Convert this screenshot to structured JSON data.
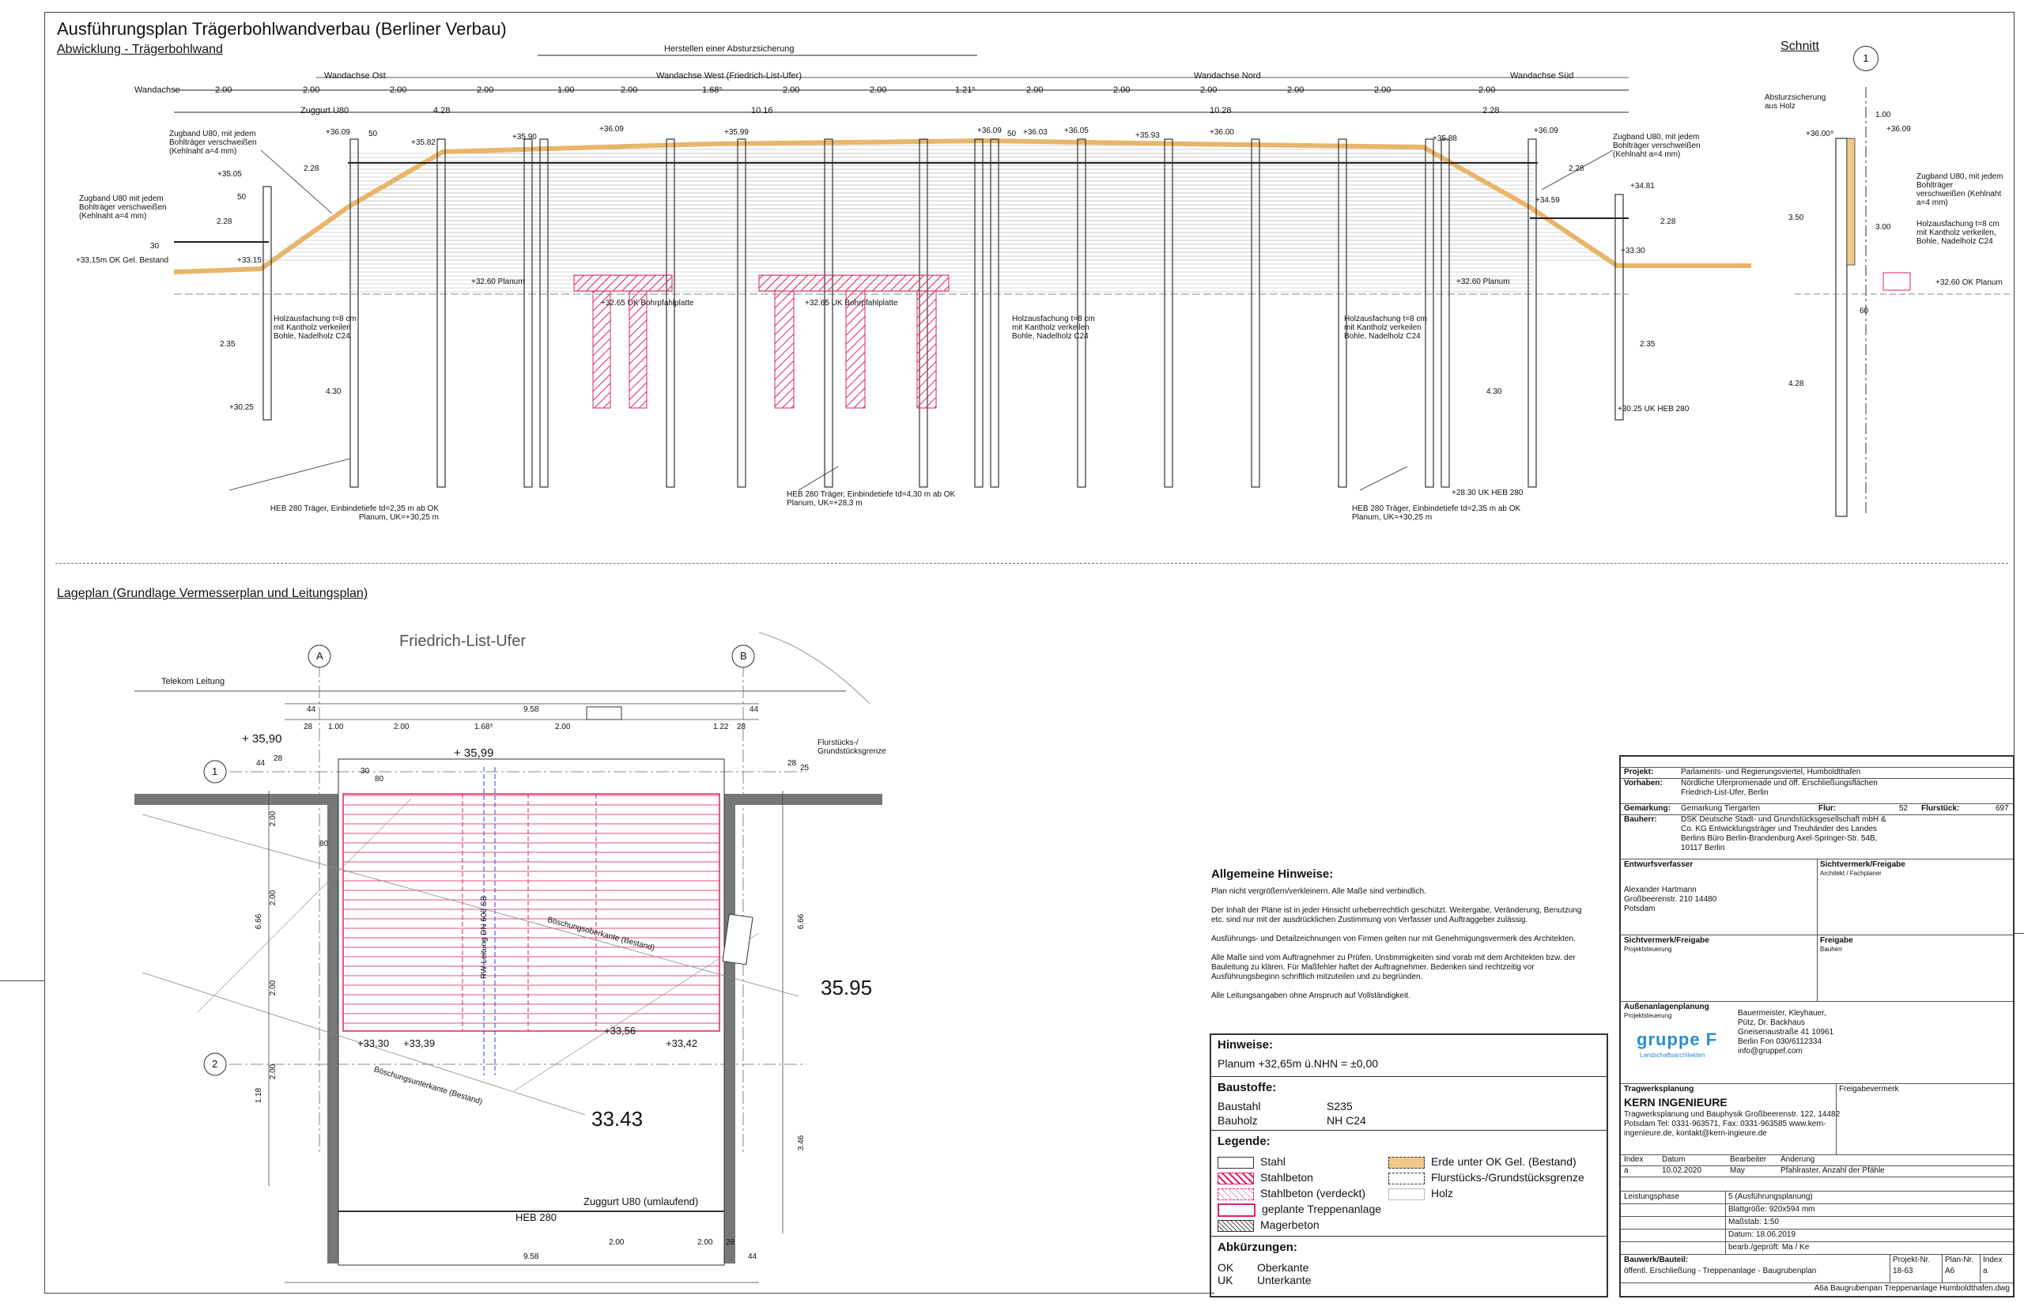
{
  "header": {
    "title": "Ausführungsplan Trägerbohlwandverbau (Berliner Verbau)",
    "subtitle_abwicklung": "Abwicklung - Trägerbohlwand",
    "subtitle_schnitt": "Schnitt",
    "subtitle_lageplan": "Lageplan (Grundlage Vermesserplan und Leitungsplan)"
  },
  "elevation": {
    "axis_labels": {
      "wandachse": "Wandachse",
      "ost": "Wandachse Ost",
      "west": "Wandachse West (Friedrich-List-Ufer)",
      "nord": "Wandachse Nord",
      "sued": "Wandachse Süd",
      "herstellen": "Herstellen einer Absturzsicherung",
      "zuggurt": "Zuggurt U80"
    },
    "dims_top": [
      "2.00",
      "2.00",
      "2.00",
      "2.00",
      "1.00",
      "2.00",
      "1.68⁵",
      "2.00",
      "2.00",
      "1.21⁵",
      "2.00",
      "2.00",
      "2.00",
      "2.00",
      "2.00",
      "2.00"
    ],
    "dims_sum": [
      "4.28",
      "10.16",
      "10.28",
      "2.28"
    ],
    "levels": [
      "+36.09",
      "+35.82",
      "+35.90",
      "+36.09",
      "+35.99",
      "+36.09",
      "+36.03",
      "+36.05",
      "+35.93",
      "+36.00",
      "+35.88",
      "+36.09",
      "+35.05",
      "+33.15",
      "+34.59",
      "+34.81",
      "+33.30",
      "+32.60 Planum",
      "+32.60 Planum",
      "+32.65 UK Bohrpfahlplatte",
      "+32.65 UK Bohrpfahlplatte",
      "+30.25",
      "+30.25 UK HEB 280",
      "+28.30 UK HEB 280",
      "+33.15m OK Gel. Bestand"
    ],
    "notes": {
      "zugband_left": "Zugband U80, mit jedem Bohlträger verschweißen (Kehlnaht a=4 mm)",
      "zugband_left2": "Zugband U80 mit jedem Bohlträger verschweißen (Kehlnaht a=4 mm)",
      "zugband_right": "Zugband U80, mit jedem Bohlträger verschweißen (Kehlnaht a=4 mm)",
      "holz": "Holzausfachung t=8 cm mit Kantholz verkeilen Bohle, Nadelholz C24",
      "heb_left": "HEB 280 Träger, Einbindetiefe td=2,35 m ab OK Planum, UK=+30,25 m",
      "heb_mid": "HEB 280 Träger, Einbindetiefe td=4,30 m ab OK Planum, UK=+28,3 m",
      "heb_right": "HEB 280 Träger, Einbindetiefe td=2,35 m ab OK Planum, UK=+30,25 m"
    },
    "small_dims": [
      "2.28",
      "2.28",
      "2.28",
      "2.28",
      "50",
      "50",
      "30",
      "50",
      "2.35",
      "4.30",
      "4.30",
      "2.35"
    ]
  },
  "section": {
    "circle": "1",
    "absturz": "Absturzsicherung aus Holz",
    "levels": [
      "+36.00⁹",
      "+36.09",
      "+32.60 OK Planum"
    ],
    "zugband": "Zugband U80, mit jedem Bohlträger verschweißen (Kehlnaht a=4 mm)",
    "holz": "Holzausfachung t=8 cm mit Kantholz verkeilen, Bohle, Nadelholz C24",
    "dims": [
      "1.00",
      "3.50",
      "3.00",
      "4.28",
      "60"
    ]
  },
  "plan": {
    "street": "Friedrich-List-Ufer",
    "telekom": "Telekom Leitung",
    "flurstueck": "Flurstücks-/ Grundstücksgrenze",
    "circles": [
      "A",
      "B",
      "1",
      "2"
    ],
    "levels": [
      "+ 35,90",
      "+ 35,99",
      "+33,30",
      "+33,39",
      "+33,56",
      "+33,42"
    ],
    "big_levels": [
      "35.95",
      "33.43"
    ],
    "dims_top": [
      "44",
      "9.58",
      "28",
      "1.00",
      "2.00",
      "1.68⁵",
      "2.00",
      "1.22",
      "28",
      "44"
    ],
    "dims_left": [
      "2.00",
      "2.00",
      "2.00",
      "2.00",
      "6.66",
      "1.18",
      "80",
      "28",
      "44",
      "30",
      "80"
    ],
    "dims_right": [
      "6.66",
      "3.46",
      "28",
      "25"
    ],
    "boeschung_ober": "Böschungsoberkante (Bestand)",
    "boeschung_unter": "Böschungsunterkante (Bestand)",
    "rw": "RW-Leitung DN 600 SB",
    "zuggurt": "Zuggurt U80 (umlaufend)",
    "heb": "HEB 280",
    "dims_bottom": [
      "2.00",
      "2.00",
      "9.58",
      "28",
      "44"
    ]
  },
  "notes": {
    "title": "Allgemeine Hinweise:",
    "lines": [
      "Plan nicht vergrößern/verkleinern. Alle Maße sind verbindlich.",
      "Der Inhalt der Pläne ist in jeder Hinsicht urheberrechtlich geschützt. Weitergabe, Veränderung, Benutzung etc. sind nur mit der ausdrücklichen Zustimmung von Verfasser und Auftraggeber zulässig.",
      "Ausführungs- und Detailzeichnungen von Firmen gelten nur mit Genehmigungsvermerk des Architekten.",
      "Alle Maße sind vom Auftragnehmer zu Prüfen, Unstimmigkeiten sind vorab mit dem Architekten bzw. der Bauleitung zu klären. Für Maßfehler haftet der Auftragnehmer. Bedenken sind rechtzeitig vor Ausführungsbeginn schriftlich mitzuteilen und zu begründen.",
      "Alle Leitungsangaben ohne Anspruch auf Vollständigkeit."
    ]
  },
  "hinweise": {
    "title": "Hinweise:",
    "planum": "Planum +32,65m ü.NHN = ±0,00",
    "baustoffe_title": "Baustoffe:",
    "baustahl": "Baustahl",
    "baustahl_v": "S235",
    "bauholz": "Bauholz",
    "bauholz_v": "NH C24",
    "legende_title": "Legende:",
    "legende": [
      "Stahl",
      "Stahlbeton",
      "Stahlbeton (verdeckt)",
      "geplante Treppenanlage",
      "Magerbeton",
      "Erde unter OK Gel. (Bestand)",
      "Flurstücks-/Grundstücksgrenze",
      "Holz"
    ],
    "abk_title": "Abkürzungen:",
    "abk": [
      [
        "OK",
        "Oberkante"
      ],
      [
        "UK",
        "Unterkante"
      ]
    ]
  },
  "titleblock": {
    "projekt_l": "Projekt:",
    "projekt": "Parlaments- und Regierungsviertel, Humboldthafen",
    "vorhaben_l": "Vorhaben:",
    "vorhaben": "Nördliche Uferpromenade und öff. Erschließungsflächen Friedrich-List-Ufer, Berlin",
    "gemarkung_l": "Gemarkung:",
    "gemarkung": "Gemarkung Tiergarten",
    "flur_l": "Flur:",
    "flur": "52",
    "flurst_l": "Flurstück:",
    "flurst": "697",
    "bauherr_l": "Bauherr:",
    "bauherr": "DSK Deutsche Stadt- und Grundstücksgesellschaft mbH & Co. KG Entwicklungsträger und Treuhänder des Landes Berlins Büro Berlin-Brandenburg Axel-Springer-Str. 54B, 10117 Berlin",
    "entwurf_l": "Entwurfsverfasser",
    "entwurf": "Alexander Hartmann Großbeerenstr. 210 14480 Potsdam",
    "sicht_l": "Sichtvermerk/Freigabe",
    "sicht_sub": "Architekt / Fachplaner",
    "sicht2_l": "Sichtvermerk/Freigabe",
    "sicht2_sub": "Projektsteuerung",
    "freigabe_l": "Freigabe",
    "freigabe_sub": "Bauherr",
    "aussen_l": "Außenanlagenplanung",
    "aussen_sub": "Projektsteuerung",
    "logo": "gruppe F",
    "logo_sub": "Landschaftsarchitekten",
    "aussen": "Bauermeister, Kleyhauer, Pütz, Dr. Backhaus Gneisenaustraße 41 10961 Berlin Fon 030/6112334 info@gruppef.com",
    "trag_l": "Tragwerksplanung",
    "trag_firm": "KERN INGENIEURE",
    "trag": "Tragwerksplanung und Bauphysik Großbeerenstr. 122, 14482 Potsdam Tel: 0331-963571, Fax: 0331-963585 www.kern-ingenieure.de, kontakt@kern-ingieure.de",
    "freigabevermerk": "Freigabevermerk",
    "idx_head": [
      "Index",
      "Datum",
      "Bearbeiter",
      "Änderung"
    ],
    "idx_row": [
      "a",
      "10.02.2020",
      "May",
      "Pfahlraster, Anzahl der Pfähle"
    ],
    "phase_l": "Leistungsphase",
    "phase": "5 (Ausführungsplanung)",
    "blatt": "Blattgröße: 920x594 mm",
    "massstab": "Maßstab: 1:50",
    "datum": "Datum: 18.06.2019",
    "bearb": "bearb./geprüft: Ma / Ke",
    "bauwerk_l": "Bauwerk/Bauteil:",
    "bauwerk": "öffentl. Erschließung - Treppenanlage - Baugrubenplan",
    "pnr_l": "Projekt-Nr.",
    "pnr": "18-63",
    "plnr_l": "Plan-Nr.",
    "plnr": "A6",
    "index_l": "Index",
    "index": "a",
    "file": "A6a Baugrubenpan Treppenanlage Humboldthafen.dwg"
  },
  "colors": {
    "line": "#222222",
    "hatch_red": "#e0245e",
    "earth": "#f2c88a",
    "wall": "#777777"
  }
}
